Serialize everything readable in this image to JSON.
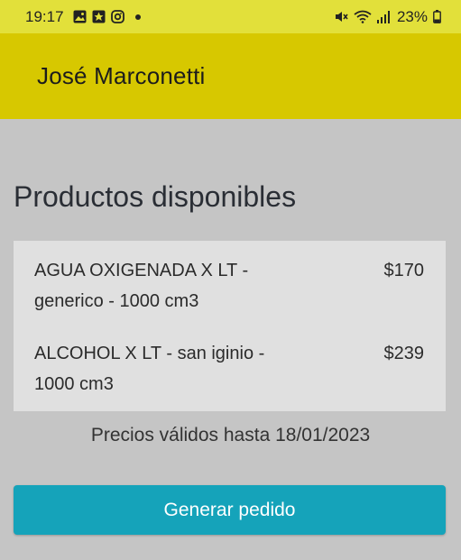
{
  "status_bar": {
    "time": "19:17",
    "left_icons": [
      "gallery-icon",
      "star-notification-icon",
      "instagram-icon"
    ],
    "right_icons": [
      "mute-icon",
      "wifi-icon",
      "signal-icon",
      "battery-icon"
    ],
    "battery_percent": "23%"
  },
  "app_bar": {
    "title": "José Marconetti",
    "color": "#d7c800"
  },
  "main": {
    "section_title": "Productos disponibles",
    "products": [
      {
        "name": "AGUA OXIGENADA X LT - generico - 1000 cm3",
        "price": "$170"
      },
      {
        "name": "ALCOHOL X LT - san iginio - 1000 cm3",
        "price": "$239"
      }
    ],
    "validity_text": "Precios válidos hasta 18/01/2023",
    "order_button_label": "Generar pedido",
    "button_color": "#15a3ba"
  }
}
